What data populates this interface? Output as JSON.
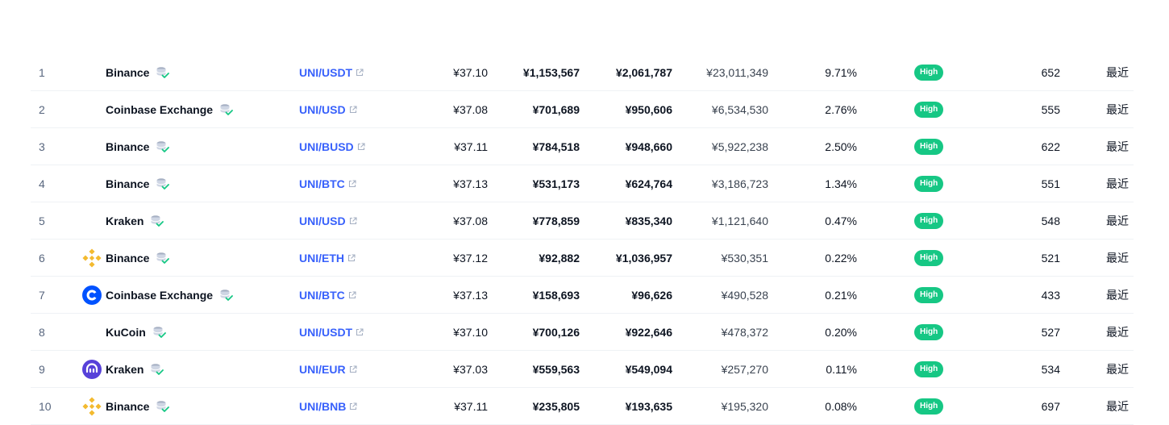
{
  "colors": {
    "pair_link": "#3861fb",
    "badge_green": "#16c784",
    "binance_yellow": "#F3BA2F",
    "coinbase_blue": "#0052FF",
    "kraken_purple": "#5741D9"
  },
  "rows": [
    {
      "rank": "1",
      "logo": "",
      "exchange": "Binance",
      "pair": "UNI/USDT",
      "price": "¥37.10",
      "depth_plus": "¥1,153,567",
      "depth_minus": "¥2,061,787",
      "volume": "¥23,011,349",
      "volume_pct": "9.71%",
      "confidence": "High",
      "liquidity": "652",
      "updated": "最近"
    },
    {
      "rank": "2",
      "logo": "",
      "exchange": "Coinbase Exchange",
      "pair": "UNI/USD",
      "price": "¥37.08",
      "depth_plus": "¥701,689",
      "depth_minus": "¥950,606",
      "volume": "¥6,534,530",
      "volume_pct": "2.76%",
      "confidence": "High",
      "liquidity": "555",
      "updated": "最近"
    },
    {
      "rank": "3",
      "logo": "",
      "exchange": "Binance",
      "pair": "UNI/BUSD",
      "price": "¥37.11",
      "depth_plus": "¥784,518",
      "depth_minus": "¥948,660",
      "volume": "¥5,922,238",
      "volume_pct": "2.50%",
      "confidence": "High",
      "liquidity": "622",
      "updated": "最近"
    },
    {
      "rank": "4",
      "logo": "",
      "exchange": "Binance",
      "pair": "UNI/BTC",
      "price": "¥37.13",
      "depth_plus": "¥531,173",
      "depth_minus": "¥624,764",
      "volume": "¥3,186,723",
      "volume_pct": "1.34%",
      "confidence": "High",
      "liquidity": "551",
      "updated": "最近"
    },
    {
      "rank": "5",
      "logo": "",
      "exchange": "Kraken",
      "pair": "UNI/USD",
      "price": "¥37.08",
      "depth_plus": "¥778,859",
      "depth_minus": "¥835,340",
      "volume": "¥1,121,640",
      "volume_pct": "0.47%",
      "confidence": "High",
      "liquidity": "548",
      "updated": "最近"
    },
    {
      "rank": "6",
      "logo": "binance",
      "exchange": "Binance",
      "pair": "UNI/ETH",
      "price": "¥37.12",
      "depth_plus": "¥92,882",
      "depth_minus": "¥1,036,957",
      "volume": "¥530,351",
      "volume_pct": "0.22%",
      "confidence": "High",
      "liquidity": "521",
      "updated": "最近"
    },
    {
      "rank": "7",
      "logo": "coinbase",
      "exchange": "Coinbase Exchange",
      "pair": "UNI/BTC",
      "price": "¥37.13",
      "depth_plus": "¥158,693",
      "depth_minus": "¥96,626",
      "volume": "¥490,528",
      "volume_pct": "0.21%",
      "confidence": "High",
      "liquidity": "433",
      "updated": "最近"
    },
    {
      "rank": "8",
      "logo": "",
      "exchange": "KuCoin",
      "pair": "UNI/USDT",
      "price": "¥37.10",
      "depth_plus": "¥700,126",
      "depth_minus": "¥922,646",
      "volume": "¥478,372",
      "volume_pct": "0.20%",
      "confidence": "High",
      "liquidity": "527",
      "updated": "最近"
    },
    {
      "rank": "9",
      "logo": "kraken",
      "exchange": "Kraken",
      "pair": "UNI/EUR",
      "price": "¥37.03",
      "depth_plus": "¥559,563",
      "depth_minus": "¥549,094",
      "volume": "¥257,270",
      "volume_pct": "0.11%",
      "confidence": "High",
      "liquidity": "534",
      "updated": "最近"
    },
    {
      "rank": "10",
      "logo": "binance",
      "exchange": "Binance",
      "pair": "UNI/BNB",
      "price": "¥37.11",
      "depth_plus": "¥235,805",
      "depth_minus": "¥193,635",
      "volume": "¥195,320",
      "volume_pct": "0.08%",
      "confidence": "High",
      "liquidity": "697",
      "updated": "最近"
    }
  ]
}
